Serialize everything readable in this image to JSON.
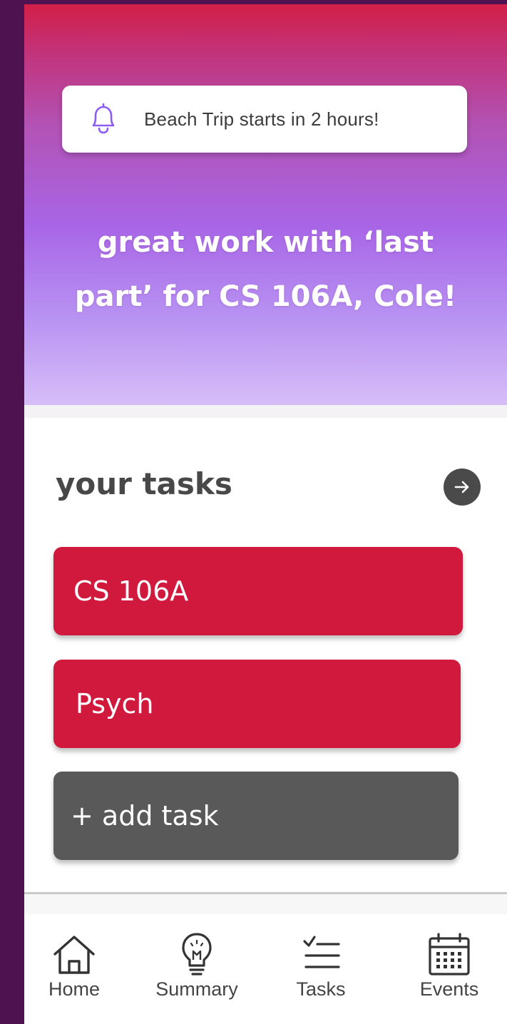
{
  "notification": {
    "icon": "bell-icon",
    "text": "Beach Trip starts in 2 hours!"
  },
  "headline": {
    "line1": "great work with ‘last",
    "line2": "part’ for CS 106A, Cole!"
  },
  "tasks": {
    "title": "your tasks",
    "arrow_icon": "arrow-right-icon",
    "items": [
      {
        "label": "CS 106A",
        "color": "#d0193c"
      },
      {
        "label": "Psych",
        "color": "#d0193c"
      }
    ],
    "add_label": "+ add task"
  },
  "nav": {
    "items": [
      {
        "label": "Home",
        "icon": "home-icon"
      },
      {
        "label": "Summary",
        "icon": "lightbulb-icon"
      },
      {
        "label": "Tasks",
        "icon": "checklist-icon"
      },
      {
        "label": "Events",
        "icon": "calendar-icon"
      }
    ]
  },
  "colors": {
    "accent_purple": "#a865e6",
    "task_red": "#d0193c",
    "add_gray": "#595959",
    "frame": "#4e1250"
  }
}
